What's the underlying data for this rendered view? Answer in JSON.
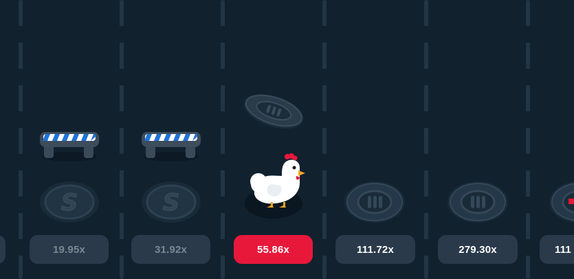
{
  "multipliers": {
    "m0": "",
    "m1": "19.95x",
    "m2": "31.92x",
    "m3": "55.86x",
    "m4": "111.72x",
    "m5": "279.30x",
    "m6": "111"
  },
  "colors": {
    "background": "#11212e",
    "lane_line": "#223746",
    "pill": "#2a3a4a",
    "active_pill": "#e8183b",
    "dim_text": "#7a8894",
    "barrier_stripe": "#1e73d8"
  },
  "icons": {
    "coin": "dollar-coin-icon",
    "manhole": "manhole-cover-icon",
    "barrier": "road-barrier-icon",
    "chicken": "chicken-icon"
  }
}
